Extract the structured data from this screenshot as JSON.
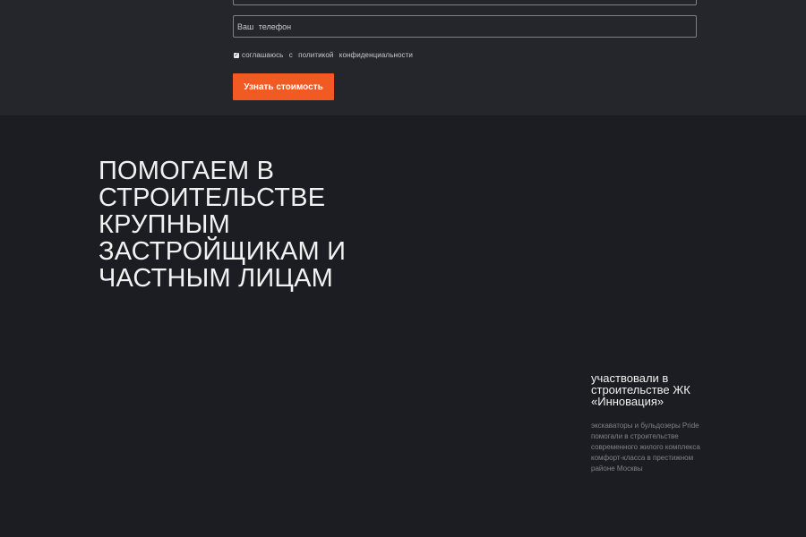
{
  "form": {
    "phone_placeholder": "Ваш телефон",
    "consent_checked": true,
    "consent_label": "соглашаюсь с политикой конфиденциальности",
    "submit_label": "Узнать стоимость",
    "accent_color": "#f15a22"
  },
  "hero": {
    "heading": "ПОМОГАЕМ В СТРОИТЕЛЬСТВЕ КРУПНЫМ ЗАСТРОЙЩИКАМ И ЧАСТНЫМ ЛИЦАМ"
  },
  "project": {
    "title": "участвовали в строительстве ЖК «Инновация»",
    "description": "экскаваторы и бульдозеры Pride помогали в строительстве современного жилого комплекса комфорт-класса в престижном районе Москвы"
  }
}
